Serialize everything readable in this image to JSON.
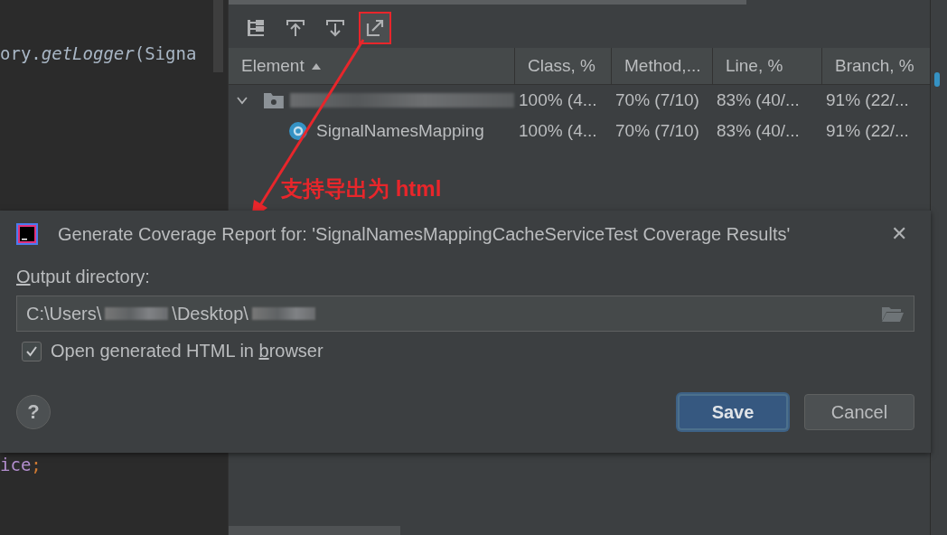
{
  "editor": {
    "lines": [
      [
        {
          "text": "ory.",
          "kind": "plain"
        },
        {
          "text": "getLogger",
          "kind": "method"
        },
        {
          "text": "(Signa",
          "kind": "plain"
        }
      ],
      [
        {
          "text": "ice",
          "kind": "field"
        },
        {
          "text": ";",
          "kind": "punct"
        }
      ]
    ]
  },
  "toolbar": {
    "buttons": [
      {
        "kind": "tree",
        "highlighted": false
      },
      {
        "kind": "import",
        "highlighted": false
      },
      {
        "kind": "download",
        "highlighted": false
      },
      {
        "kind": "export",
        "highlighted": true
      }
    ]
  },
  "table": {
    "columns": [
      {
        "label": "Element",
        "sorted": true
      },
      {
        "label": "Class, %",
        "sorted": false
      },
      {
        "label": "Method,...",
        "sorted": false
      },
      {
        "label": "Line, %",
        "sorted": false
      },
      {
        "label": "Branch, %",
        "sorted": false
      }
    ],
    "rows": [
      {
        "kind": "package",
        "expanded": true,
        "cells": [
          "",
          "100% (4...",
          "70% (7/10)",
          "83% (40/...",
          "91% (22/..."
        ]
      },
      {
        "kind": "class",
        "cells": [
          "SignalNamesMapping",
          "100% (4...",
          "70% (7/10)",
          "83% (40/...",
          "91% (22/..."
        ]
      }
    ]
  },
  "annotation": {
    "text": "支持导出为 html"
  },
  "dialog": {
    "title": "Generate Coverage Report for: 'SignalNamesMappingCacheServiceTest Coverage Results'",
    "close": "✕",
    "output_label": {
      "mnemonic": "O",
      "after": "utput directory:"
    },
    "path_parts": [
      {
        "kind": "text",
        "text": "C:\\Users\\"
      },
      {
        "kind": "redacted"
      },
      {
        "kind": "text",
        "text": "\\Desktop\\"
      },
      {
        "kind": "redacted"
      }
    ],
    "open_in_browser": {
      "before": "Open generated HTML in ",
      "mnemonic": "b",
      "after": "rowser",
      "checked": true
    },
    "help": "?",
    "buttons": [
      {
        "label": "Save",
        "default": true
      },
      {
        "label": "Cancel",
        "default": false
      }
    ]
  }
}
